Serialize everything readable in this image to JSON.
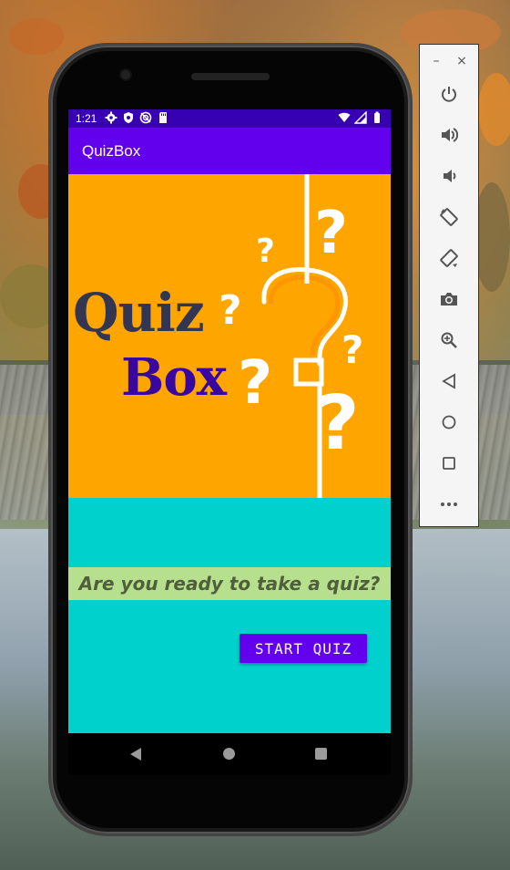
{
  "status_bar": {
    "time": "1:21",
    "left_icons": [
      "settings-icon",
      "shield-icon",
      "sync-off-icon",
      "sd-card-icon"
    ],
    "right_icons": [
      "wifi-icon",
      "signal-icon",
      "battery-icon"
    ]
  },
  "app_bar": {
    "title": "QuizBox"
  },
  "banner": {
    "logo_line1": "Quiz",
    "logo_line2": "Box",
    "question_mark": "?"
  },
  "main": {
    "prompt": "Are you ready to take a quiz?",
    "start_button": "START QUIZ"
  },
  "nav_bar": {
    "buttons": [
      "back-icon",
      "home-icon",
      "recents-icon"
    ]
  },
  "emulator_panel": {
    "minimize": "–",
    "close": "×",
    "tools": [
      "power-icon",
      "volume-up-icon",
      "volume-down-icon",
      "rotate-left-icon",
      "rotate-right-icon",
      "camera-icon",
      "zoom-icon",
      "back-icon",
      "home-icon",
      "overview-icon",
      "more-icon"
    ]
  },
  "colors": {
    "status_bar": "#3700b3",
    "app_bar": "#6200ee",
    "banner_bg": "#ffa500",
    "screen_bg": "#00d1cc",
    "prompt_strip": "#b6e08e",
    "button": "#6200ee",
    "logo_quiz": "#333652",
    "logo_box": "#3a06a0"
  }
}
